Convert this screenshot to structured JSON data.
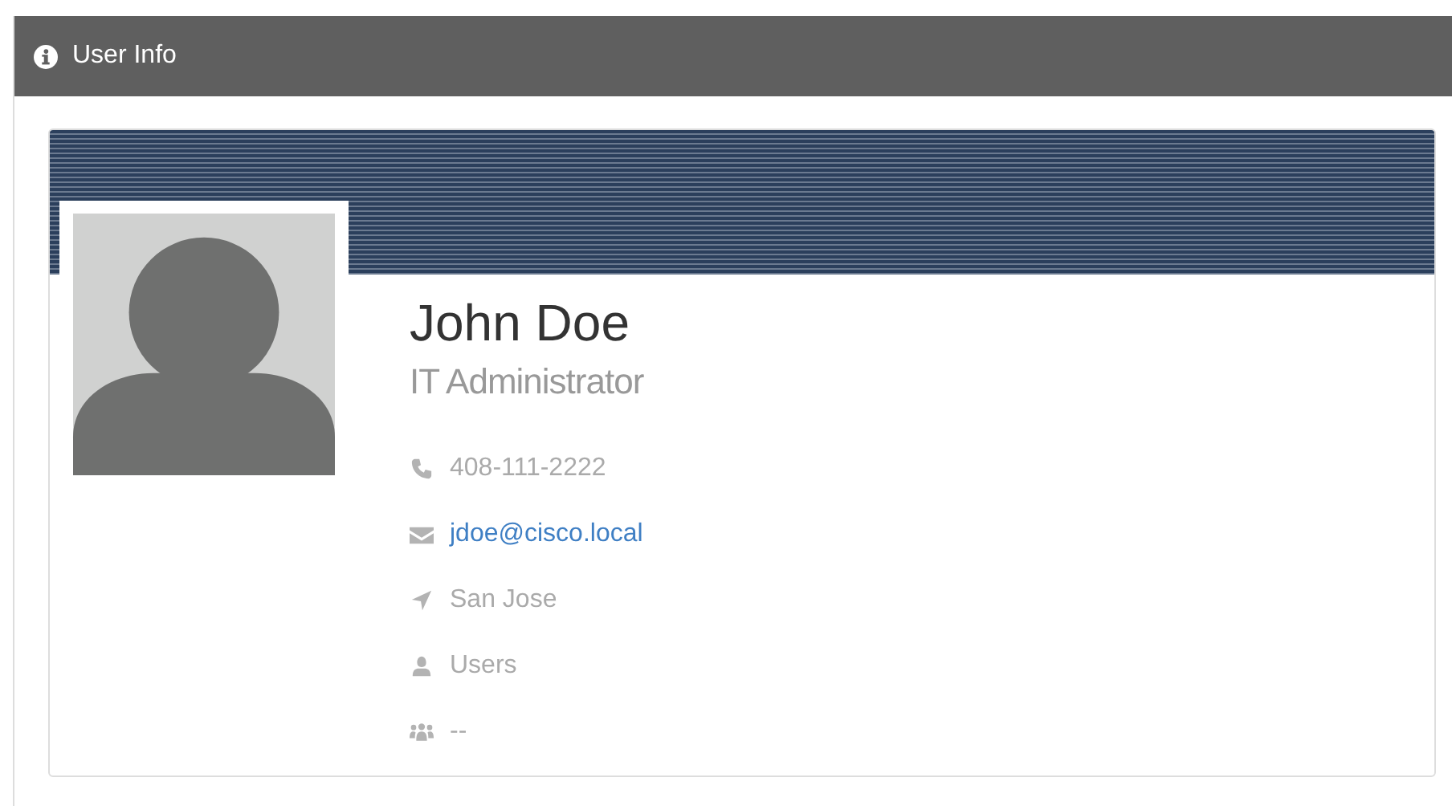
{
  "panel": {
    "title": "User Info"
  },
  "profile": {
    "name": "John Doe",
    "job_title": "IT Administrator",
    "details": [
      {
        "kind": "phone",
        "text": "408-111-2222"
      },
      {
        "kind": "email",
        "text": "jdoe@cisco.local"
      },
      {
        "kind": "location",
        "text": "San Jose"
      },
      {
        "kind": "user",
        "text": "Users"
      },
      {
        "kind": "group",
        "text": "--"
      }
    ]
  }
}
